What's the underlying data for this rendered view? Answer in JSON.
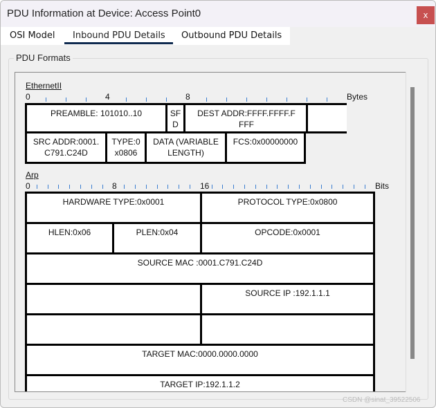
{
  "window": {
    "title": "PDU Information at Device: Access Point0",
    "close_label": "x"
  },
  "tabs": [
    {
      "label": "OSI Model"
    },
    {
      "label": "Inbound PDU Details",
      "active": true
    },
    {
      "label": "Outbound PDU Details"
    }
  ],
  "group_label": "PDU Formats",
  "ethernet": {
    "title": "EthernetII",
    "ruler": [
      "0",
      "4",
      "8"
    ],
    "unit": "Bytes",
    "fields": [
      "PREAMBLE: 101010..10",
      "SF D",
      "DEST ADDR:FFFF.FFFF.F FFF",
      "",
      "SRC ADDR:0001. C791.C24D",
      "TYPE:0 x0806",
      "DATA (VARIABLE LENGTH)",
      "FCS:0x00000000"
    ]
  },
  "arp": {
    "title": "Arp",
    "ruler": [
      "0",
      "8",
      "16"
    ],
    "unit": "Bits",
    "fields": [
      "HARDWARE TYPE:0x0001",
      "PROTOCOL TYPE:0x0800",
      "HLEN:0x06",
      "PLEN:0x04",
      "OPCODE:0x0001",
      "SOURCE MAC :0001.C791.C24D",
      "",
      "SOURCE IP :192.1.1.1",
      "",
      "",
      "TARGET MAC:0000.0000.0000",
      "TARGET IP:192.1.1.2"
    ]
  },
  "watermark": "CSDN @sinat_39522506"
}
